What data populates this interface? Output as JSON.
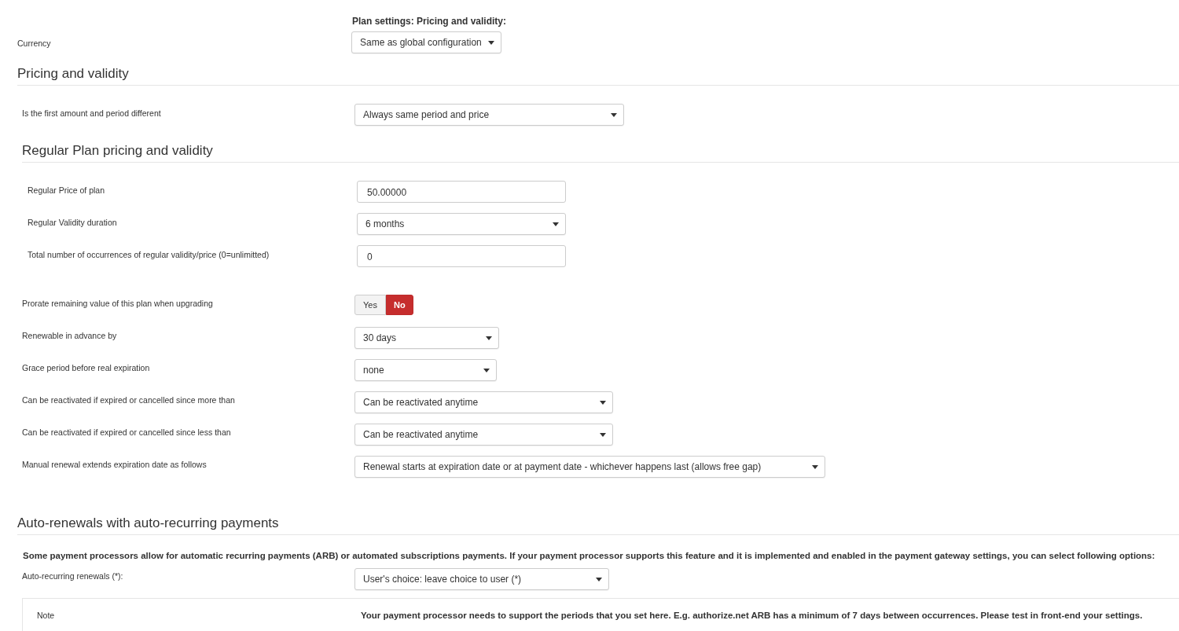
{
  "page_title": "Plan settings: Pricing and validity:",
  "currency": {
    "label": "Currency",
    "value": "Same as global configuration"
  },
  "sections": [
    {
      "title": "Pricing and validity",
      "rows": [
        {
          "kind": "select",
          "label": "Is the first amount and period different",
          "value": "Always same period and price"
        }
      ]
    },
    {
      "title": "Regular Plan pricing and validity",
      "rows": [
        {
          "kind": "input",
          "label": "Regular Price of plan",
          "value": "50.00000"
        },
        {
          "kind": "select",
          "label": "Regular Validity duration",
          "value": "6 months"
        },
        {
          "kind": "input",
          "label": "Total number of occurrences of regular validity/price (0=unlimitted)",
          "value": "0"
        }
      ]
    }
  ],
  "settings": [
    {
      "kind": "toggle",
      "label": "Prorate remaining value of this plan when upgrading",
      "options": [
        {
          "label": "Yes",
          "selected": false
        },
        {
          "label": "No",
          "selected": true
        }
      ]
    },
    {
      "kind": "select",
      "label": "Renewable in advance by",
      "value": "30 days"
    },
    {
      "kind": "select",
      "label": "Grace period before real expiration",
      "value": "none"
    },
    {
      "kind": "select",
      "label": "Can be reactivated if expired or cancelled since more than",
      "value": "Can be reactivated anytime"
    },
    {
      "kind": "select",
      "label": "Can be reactivated if expired or cancelled since less than",
      "value": "Can be reactivated anytime"
    },
    {
      "kind": "select",
      "label": "Manual renewal extends expiration date as follows",
      "value": "Renewal starts at expiration date or at payment date - whichever happens last (allows free gap)"
    }
  ],
  "auto": {
    "title": "Auto-renewals with auto-recurring payments",
    "intro": "Some payment processors allow for automatic recurring payments (ARB) or automated subscriptions payments. If your payment processor supports this feature and it is implemented and enabled in the payment gateway settings, you can select following options:",
    "rows": [
      {
        "kind": "select",
        "label": "Auto-recurring renewals (*):",
        "value": "User's choice: leave choice to user (*)"
      }
    ],
    "note": {
      "label": "Note",
      "text": "Your payment processor needs to support the periods that you set here. E.g. authorize.net ARB has a minimum of 7 days between occurrences. Please test in front-end your settings."
    }
  }
}
